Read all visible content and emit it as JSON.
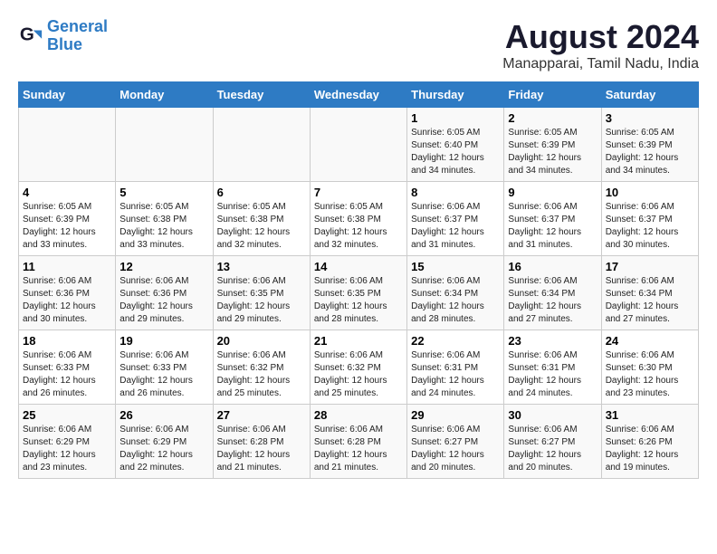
{
  "header": {
    "logo_line1": "General",
    "logo_line2": "Blue",
    "month": "August 2024",
    "location": "Manapparai, Tamil Nadu, India"
  },
  "days_of_week": [
    "Sunday",
    "Monday",
    "Tuesday",
    "Wednesday",
    "Thursday",
    "Friday",
    "Saturday"
  ],
  "weeks": [
    [
      {
        "day": "",
        "info": ""
      },
      {
        "day": "",
        "info": ""
      },
      {
        "day": "",
        "info": ""
      },
      {
        "day": "",
        "info": ""
      },
      {
        "day": "1",
        "info": "Sunrise: 6:05 AM\nSunset: 6:40 PM\nDaylight: 12 hours\nand 34 minutes."
      },
      {
        "day": "2",
        "info": "Sunrise: 6:05 AM\nSunset: 6:39 PM\nDaylight: 12 hours\nand 34 minutes."
      },
      {
        "day": "3",
        "info": "Sunrise: 6:05 AM\nSunset: 6:39 PM\nDaylight: 12 hours\nand 34 minutes."
      }
    ],
    [
      {
        "day": "4",
        "info": "Sunrise: 6:05 AM\nSunset: 6:39 PM\nDaylight: 12 hours\nand 33 minutes."
      },
      {
        "day": "5",
        "info": "Sunrise: 6:05 AM\nSunset: 6:38 PM\nDaylight: 12 hours\nand 33 minutes."
      },
      {
        "day": "6",
        "info": "Sunrise: 6:05 AM\nSunset: 6:38 PM\nDaylight: 12 hours\nand 32 minutes."
      },
      {
        "day": "7",
        "info": "Sunrise: 6:05 AM\nSunset: 6:38 PM\nDaylight: 12 hours\nand 32 minutes."
      },
      {
        "day": "8",
        "info": "Sunrise: 6:06 AM\nSunset: 6:37 PM\nDaylight: 12 hours\nand 31 minutes."
      },
      {
        "day": "9",
        "info": "Sunrise: 6:06 AM\nSunset: 6:37 PM\nDaylight: 12 hours\nand 31 minutes."
      },
      {
        "day": "10",
        "info": "Sunrise: 6:06 AM\nSunset: 6:37 PM\nDaylight: 12 hours\nand 30 minutes."
      }
    ],
    [
      {
        "day": "11",
        "info": "Sunrise: 6:06 AM\nSunset: 6:36 PM\nDaylight: 12 hours\nand 30 minutes."
      },
      {
        "day": "12",
        "info": "Sunrise: 6:06 AM\nSunset: 6:36 PM\nDaylight: 12 hours\nand 29 minutes."
      },
      {
        "day": "13",
        "info": "Sunrise: 6:06 AM\nSunset: 6:35 PM\nDaylight: 12 hours\nand 29 minutes."
      },
      {
        "day": "14",
        "info": "Sunrise: 6:06 AM\nSunset: 6:35 PM\nDaylight: 12 hours\nand 28 minutes."
      },
      {
        "day": "15",
        "info": "Sunrise: 6:06 AM\nSunset: 6:34 PM\nDaylight: 12 hours\nand 28 minutes."
      },
      {
        "day": "16",
        "info": "Sunrise: 6:06 AM\nSunset: 6:34 PM\nDaylight: 12 hours\nand 27 minutes."
      },
      {
        "day": "17",
        "info": "Sunrise: 6:06 AM\nSunset: 6:34 PM\nDaylight: 12 hours\nand 27 minutes."
      }
    ],
    [
      {
        "day": "18",
        "info": "Sunrise: 6:06 AM\nSunset: 6:33 PM\nDaylight: 12 hours\nand 26 minutes."
      },
      {
        "day": "19",
        "info": "Sunrise: 6:06 AM\nSunset: 6:33 PM\nDaylight: 12 hours\nand 26 minutes."
      },
      {
        "day": "20",
        "info": "Sunrise: 6:06 AM\nSunset: 6:32 PM\nDaylight: 12 hours\nand 25 minutes."
      },
      {
        "day": "21",
        "info": "Sunrise: 6:06 AM\nSunset: 6:32 PM\nDaylight: 12 hours\nand 25 minutes."
      },
      {
        "day": "22",
        "info": "Sunrise: 6:06 AM\nSunset: 6:31 PM\nDaylight: 12 hours\nand 24 minutes."
      },
      {
        "day": "23",
        "info": "Sunrise: 6:06 AM\nSunset: 6:31 PM\nDaylight: 12 hours\nand 24 minutes."
      },
      {
        "day": "24",
        "info": "Sunrise: 6:06 AM\nSunset: 6:30 PM\nDaylight: 12 hours\nand 23 minutes."
      }
    ],
    [
      {
        "day": "25",
        "info": "Sunrise: 6:06 AM\nSunset: 6:29 PM\nDaylight: 12 hours\nand 23 minutes."
      },
      {
        "day": "26",
        "info": "Sunrise: 6:06 AM\nSunset: 6:29 PM\nDaylight: 12 hours\nand 22 minutes."
      },
      {
        "day": "27",
        "info": "Sunrise: 6:06 AM\nSunset: 6:28 PM\nDaylight: 12 hours\nand 21 minutes."
      },
      {
        "day": "28",
        "info": "Sunrise: 6:06 AM\nSunset: 6:28 PM\nDaylight: 12 hours\nand 21 minutes."
      },
      {
        "day": "29",
        "info": "Sunrise: 6:06 AM\nSunset: 6:27 PM\nDaylight: 12 hours\nand 20 minutes."
      },
      {
        "day": "30",
        "info": "Sunrise: 6:06 AM\nSunset: 6:27 PM\nDaylight: 12 hours\nand 20 minutes."
      },
      {
        "day": "31",
        "info": "Sunrise: 6:06 AM\nSunset: 6:26 PM\nDaylight: 12 hours\nand 19 minutes."
      }
    ]
  ]
}
